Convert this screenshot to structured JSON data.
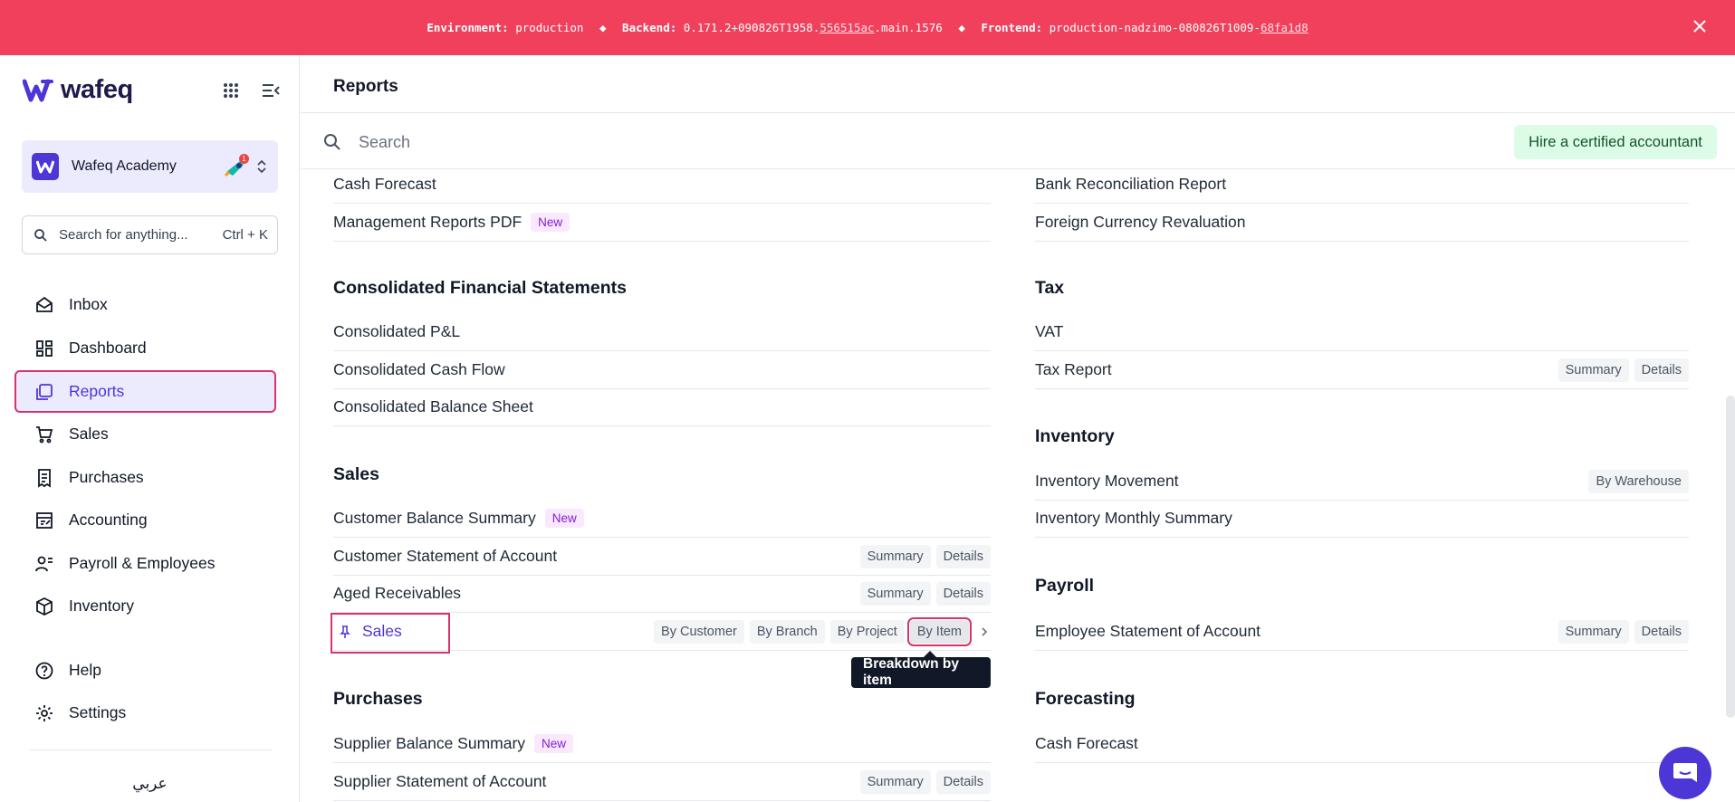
{
  "banner": {
    "env_label": "Environment:",
    "env_value": "production",
    "backend_label": "Backend:",
    "backend_prefix": "0.171.2+090826T1958.",
    "backend_hash": "556515ac",
    "backend_suffix": ".main.1576",
    "frontend_label": "Frontend:",
    "frontend_prefix": "production-nadzimo-080826T1009-",
    "frontend_hash": "68fa1d8",
    "separator": "◆"
  },
  "brand": {
    "name": "wafeq"
  },
  "org": {
    "name": "Wafeq Academy",
    "badge_count": "1"
  },
  "sidebar_search": {
    "placeholder": "Search for anything...",
    "shortcut": "Ctrl + K"
  },
  "nav": [
    {
      "label": "Inbox",
      "icon": "inbox-icon"
    },
    {
      "label": "Dashboard",
      "icon": "dashboard-icon"
    },
    {
      "label": "Reports",
      "icon": "reports-icon",
      "active": true
    },
    {
      "label": "Sales",
      "icon": "cart-icon"
    },
    {
      "label": "Purchases",
      "icon": "receipt-icon"
    },
    {
      "label": "Accounting",
      "icon": "ledger-icon"
    },
    {
      "label": "Payroll & Employees",
      "icon": "people-icon"
    },
    {
      "label": "Inventory",
      "icon": "box-icon"
    },
    {
      "label": "Help",
      "icon": "help-icon"
    },
    {
      "label": "Settings",
      "icon": "gear-icon"
    }
  ],
  "language_toggle": "عربي",
  "page": {
    "title": "Reports",
    "search_placeholder": "Search",
    "hire_button": "Hire a certified accountant"
  },
  "left": {
    "top_rows": [
      {
        "name": "Cash Forecast"
      },
      {
        "name": "Management Reports PDF",
        "badge": "New"
      }
    ],
    "consolidated": {
      "title": "Consolidated Financial Statements",
      "rows": [
        "Consolidated P&L",
        "Consolidated Cash Flow",
        "Consolidated Balance Sheet"
      ]
    },
    "sales": {
      "title": "Sales",
      "rows": [
        {
          "name": "Customer Balance Summary",
          "badge": "New"
        },
        {
          "name": "Customer Statement of Account",
          "tags": [
            "Summary",
            "Details"
          ]
        },
        {
          "name": "Aged Receivables",
          "tags": [
            "Summary",
            "Details"
          ]
        },
        {
          "name": "Sales",
          "tags": [
            "By Customer",
            "By Branch",
            "By Project",
            "By Item"
          ]
        }
      ],
      "tooltip": "Breakdown by item"
    },
    "purchases": {
      "title": "Purchases",
      "rows": [
        {
          "name": "Supplier Balance Summary",
          "badge": "New"
        },
        {
          "name": "Supplier Statement of Account",
          "tags": [
            "Summary",
            "Details"
          ]
        }
      ]
    }
  },
  "right": {
    "top_rows": [
      "Bank Reconciliation Report",
      "Foreign Currency Revaluation"
    ],
    "tax": {
      "title": "Tax",
      "rows": [
        {
          "name": "VAT"
        },
        {
          "name": "Tax Report",
          "tags": [
            "Summary",
            "Details"
          ]
        }
      ]
    },
    "inventory": {
      "title": "Inventory",
      "rows": [
        {
          "name": "Inventory Movement",
          "tags": [
            "By Warehouse"
          ]
        },
        {
          "name": "Inventory Monthly Summary"
        }
      ]
    },
    "payroll": {
      "title": "Payroll",
      "rows": [
        {
          "name": "Employee Statement of Account",
          "tags": [
            "Summary",
            "Details"
          ]
        }
      ]
    },
    "forecasting": {
      "title": "Forecasting",
      "rows": [
        {
          "name": "Cash Forecast"
        }
      ]
    }
  }
}
